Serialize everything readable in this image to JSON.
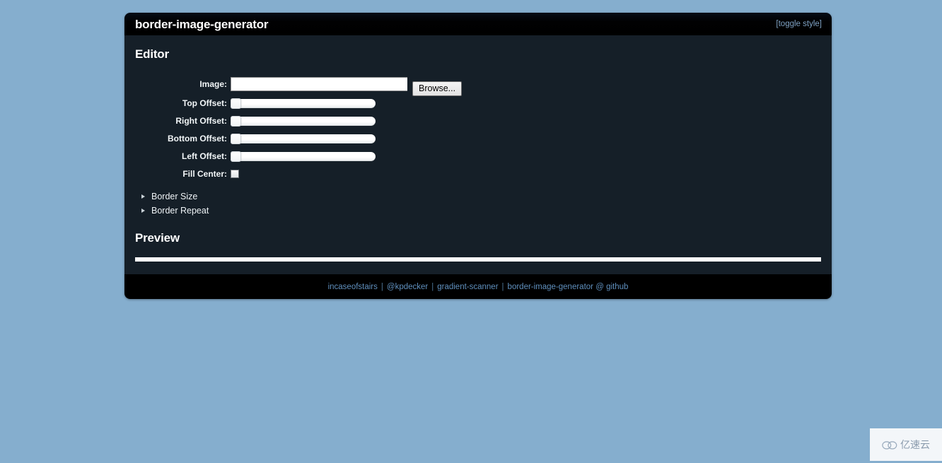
{
  "window": {
    "title": "border-image-generator",
    "toggle_style_label": "[toggle style]"
  },
  "editor": {
    "heading": "Editor",
    "fields": [
      {
        "label": "Image:",
        "type": "file",
        "value": "",
        "button_label": "Browse..."
      },
      {
        "label": "Top Offset:",
        "type": "slider",
        "value": 0
      },
      {
        "label": "Right Offset:",
        "type": "slider",
        "value": 0
      },
      {
        "label": "Bottom Offset:",
        "type": "slider",
        "value": 0
      },
      {
        "label": "Left Offset:",
        "type": "slider",
        "value": 0
      },
      {
        "label": "Fill Center:",
        "type": "checkbox",
        "checked": false
      }
    ],
    "groups": [
      {
        "label": "Border Size",
        "expanded": false,
        "icon": "triangle-right-icon"
      },
      {
        "label": "Border Repeat",
        "expanded": false,
        "icon": "triangle-right-icon"
      }
    ]
  },
  "preview": {
    "heading": "Preview"
  },
  "footer": {
    "links": [
      "incaseofstairs",
      "@kpdecker",
      "gradient-scanner",
      "border-image-generator @ github"
    ],
    "separator": "|"
  },
  "watermark": {
    "text": "亿速云",
    "icon": "cloud-icon"
  },
  "colors": {
    "page_background": "#85aece",
    "panel_background": "#151f28",
    "titlebar_background": "#000000",
    "footer_background": "#000000",
    "link": "#5f8fbd",
    "text": "#ffffff"
  }
}
